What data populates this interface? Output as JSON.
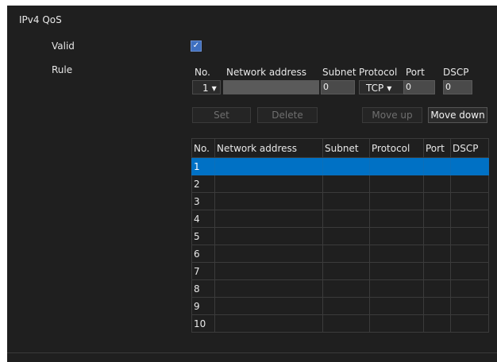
{
  "section": {
    "title": "IPv4 QoS"
  },
  "labels": {
    "valid": "Valid",
    "rule": "Rule"
  },
  "valid_checked": true,
  "rule_form": {
    "headers": {
      "no": "No.",
      "network_address": "Network address",
      "subnet": "Subnet",
      "protocol": "Protocol",
      "port": "Port",
      "dscp": "DSCP"
    },
    "no_value": "1",
    "network_address_value": "",
    "subnet_value": "0",
    "protocol_value": "TCP",
    "port_value": "0",
    "dscp_value": "0"
  },
  "buttons": {
    "set": "Set",
    "delete": "Delete",
    "move_up": "Move up",
    "move_down": "Move down"
  },
  "table": {
    "columns": [
      "No.",
      "Network address",
      "Subnet",
      "Protocol",
      "Port",
      "DSCP"
    ],
    "rows": [
      {
        "no": "1",
        "network_address": "",
        "subnet": "",
        "protocol": "",
        "port": "",
        "dscp": ""
      },
      {
        "no": "2",
        "network_address": "",
        "subnet": "",
        "protocol": "",
        "port": "",
        "dscp": ""
      },
      {
        "no": "3",
        "network_address": "",
        "subnet": "",
        "protocol": "",
        "port": "",
        "dscp": ""
      },
      {
        "no": "4",
        "network_address": "",
        "subnet": "",
        "protocol": "",
        "port": "",
        "dscp": ""
      },
      {
        "no": "5",
        "network_address": "",
        "subnet": "",
        "protocol": "",
        "port": "",
        "dscp": ""
      },
      {
        "no": "6",
        "network_address": "",
        "subnet": "",
        "protocol": "",
        "port": "",
        "dscp": ""
      },
      {
        "no": "7",
        "network_address": "",
        "subnet": "",
        "protocol": "",
        "port": "",
        "dscp": ""
      },
      {
        "no": "8",
        "network_address": "",
        "subnet": "",
        "protocol": "",
        "port": "",
        "dscp": ""
      },
      {
        "no": "9",
        "network_address": "",
        "subnet": "",
        "protocol": "",
        "port": "",
        "dscp": ""
      },
      {
        "no": "10",
        "network_address": "",
        "subnet": "",
        "protocol": "",
        "port": "",
        "dscp": ""
      }
    ],
    "selected_row": "1"
  },
  "icons": {
    "checkbox": "checkmark-icon",
    "dropdown": "caret-down-icon"
  },
  "colors": {
    "background": "#1f1f1f",
    "selection": "#0071c5",
    "checkbox": "#3e6fbf"
  }
}
